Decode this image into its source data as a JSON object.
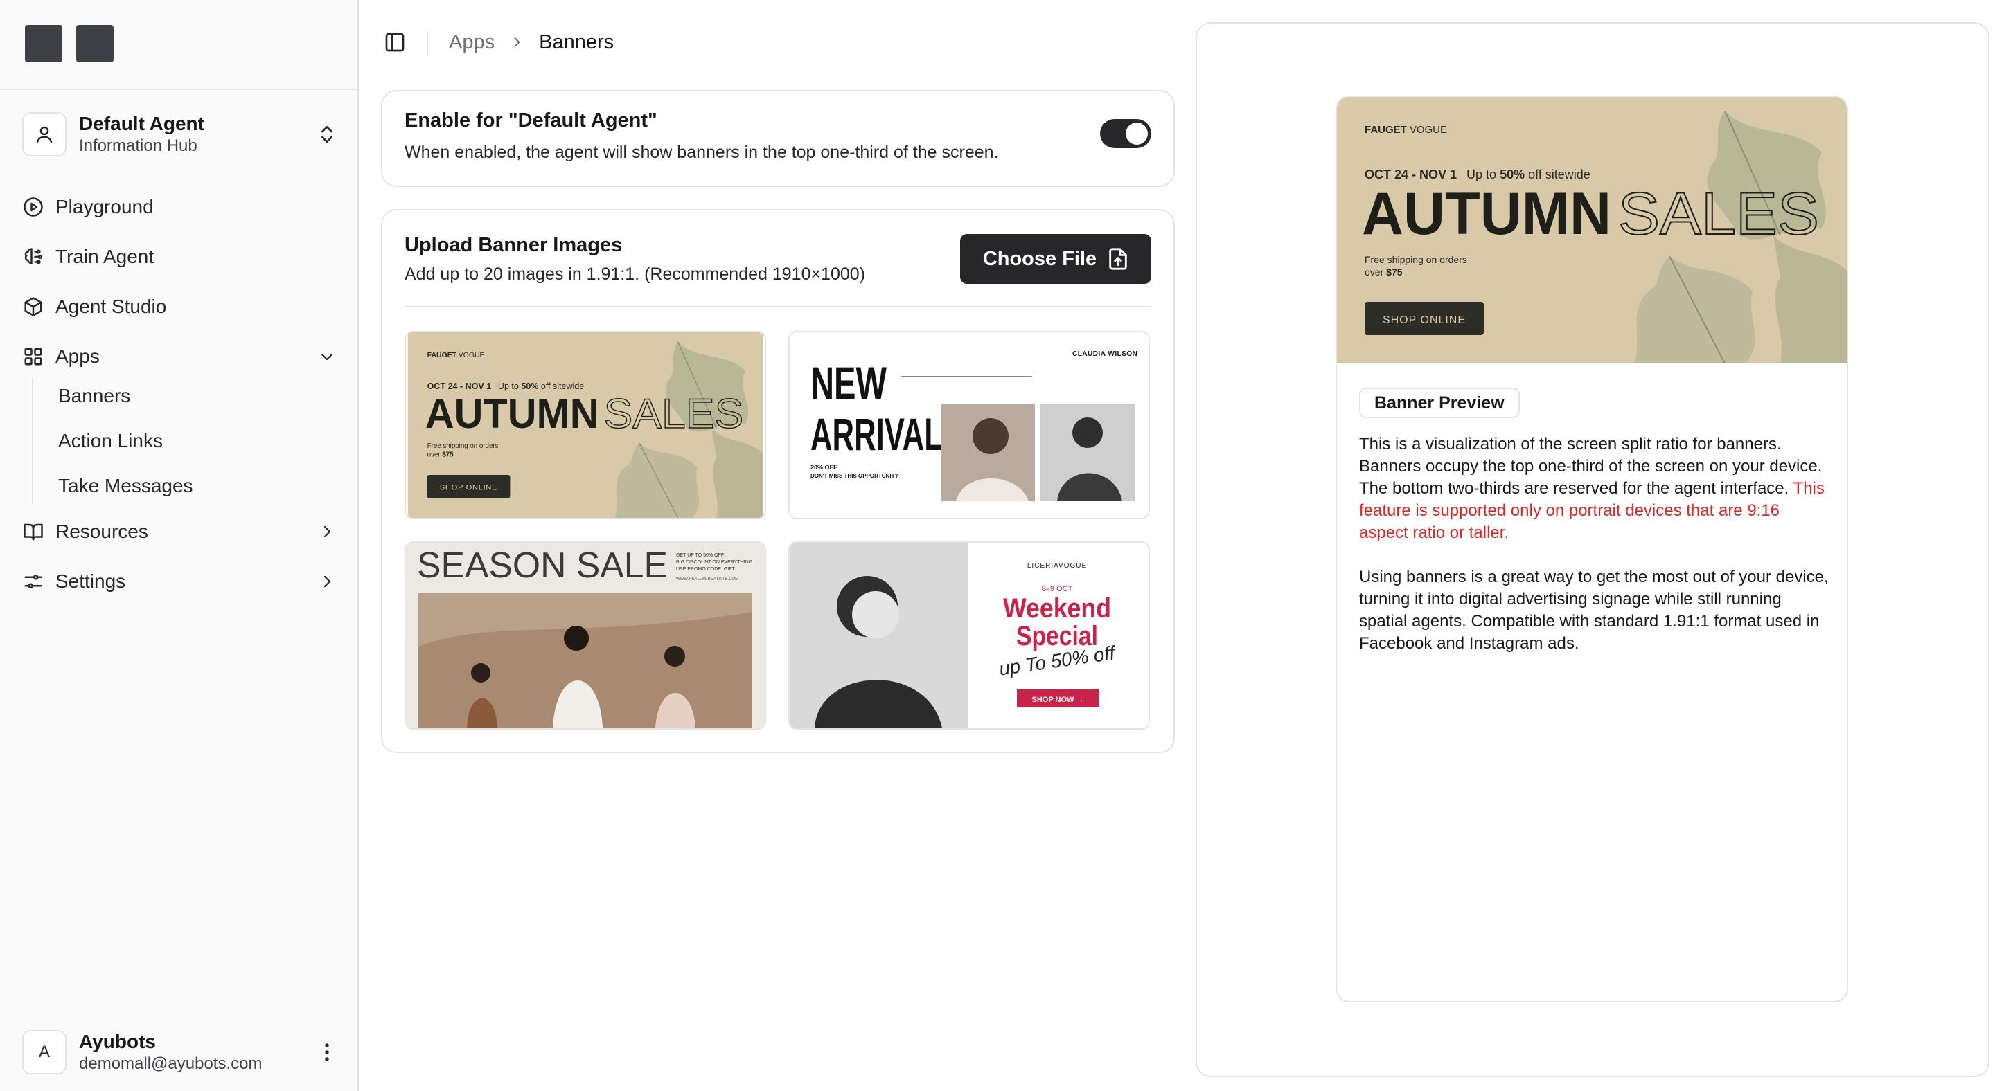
{
  "sidebar": {
    "agent": {
      "name": "Default Agent",
      "subtitle": "Information Hub"
    },
    "nav": [
      {
        "label": "Playground",
        "icon": "play-circle-icon"
      },
      {
        "label": "Train Agent",
        "icon": "brain-icon"
      },
      {
        "label": "Agent Studio",
        "icon": "cube-icon"
      },
      {
        "label": "Apps",
        "icon": "grid-icon",
        "expanded": true
      },
      {
        "label": "Resources",
        "icon": "book-icon"
      },
      {
        "label": "Settings",
        "icon": "sliders-icon"
      }
    ],
    "apps_sub": [
      "Banners",
      "Action Links",
      "Take Messages"
    ],
    "user": {
      "initial": "A",
      "name": "Ayubots",
      "email": "demomall@ayubots.com"
    }
  },
  "breadcrumb": {
    "root": "Apps",
    "current": "Banners"
  },
  "enable_card": {
    "title": "Enable for \"Default Agent\"",
    "description": "When enabled, the agent will show banners in the top one-third of the screen.",
    "enabled": true
  },
  "upload_card": {
    "title": "Upload Banner Images",
    "description": "Add up to 20 images in 1.91:1. (Recommended 1910×1000)",
    "button_label": "Choose File"
  },
  "banners": {
    "autumn": {
      "brand_a": "FAUGET",
      "brand_b": "VOGUE",
      "dates": "OCT 24 - NOV 1",
      "promo_a": "Up to ",
      "promo_pct": "50%",
      "promo_b": " off sitewide",
      "word1": "AUTUMN",
      "word2": "SALES",
      "ship1": "Free shipping on orders",
      "ship2": "over ",
      "ship_amt": "$75",
      "cta": "SHOP ONLINE"
    },
    "arrivals": {
      "line1": "NEW",
      "line2": "ARRIVALS",
      "brand": "CLAUDIA WILSON",
      "offer1": "20% OFF",
      "offer2": "DON'T MISS THIS OPPORTUNITY"
    },
    "season": {
      "title": "SEASON SALE",
      "note1": "GET UP TO 50% OFF",
      "note2": "BIG DISCOUNT ON EVERYTHING",
      "note3": "USE PROMO CODE: GIFT",
      "site": "WWW.REALLYGREATSITE.COM"
    },
    "weekend": {
      "brand": "LICERIAVOGUE",
      "dates": "8–9 OCT",
      "line1": "Weekend",
      "line2": "Special",
      "script": "up To 50% off",
      "cta": "SHOP NOW →"
    }
  },
  "preview": {
    "badge": "Banner Preview",
    "p1_a": "This is a visualization of the screen split ratio for banners. Banners occupy the top one-third of the screen on your device. The bottom two-thirds are reserved for the agent interface. ",
    "p1_warn": "This feature is supported only on portrait devices that are 9:16 aspect ratio or taller.",
    "p2": "Using banners is a great way to get the most out of your device, turning it into digital advertising signage while still running spatial agents. Compatible with standard 1.91:1 format used in Facebook and Instagram ads."
  },
  "colors": {
    "accent_dark": "#27272a",
    "warning": "#dc2626",
    "autumn_bg": "#d8c9a8",
    "weekend_red": "#c8234a"
  }
}
